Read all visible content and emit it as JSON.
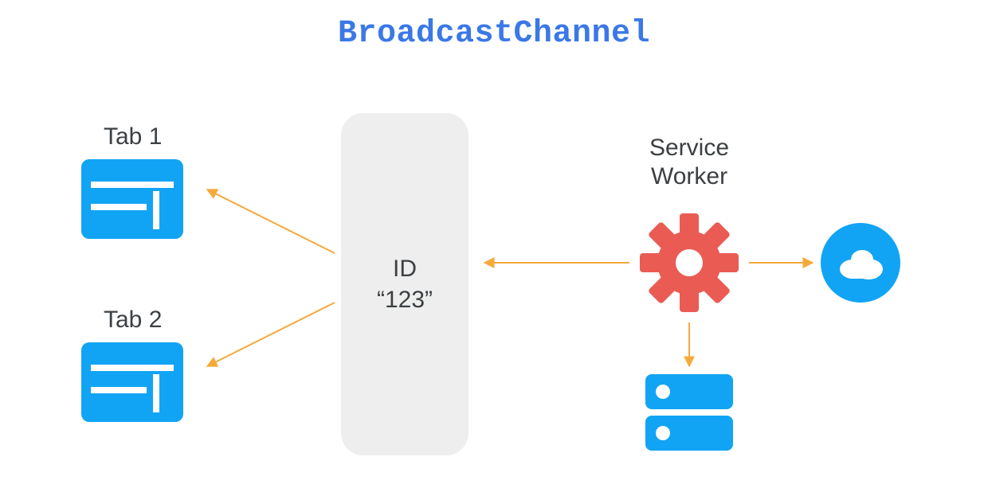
{
  "title": "BroadcastChannel",
  "channel": {
    "label_line1": "ID",
    "label_line2": "“123”"
  },
  "tabs": [
    {
      "label": "Tab 1"
    },
    {
      "label": "Tab 2"
    }
  ],
  "service_worker": {
    "label_line1": "Service",
    "label_line2": "Worker"
  },
  "colors": {
    "title": "#3b78e7",
    "pill": "#eeeeee",
    "blue": "#12a4f4",
    "red": "#ea5b54",
    "arrow": "#f6a93b",
    "white": "#ffffff",
    "text": "#3c4043"
  },
  "icons": {
    "tab": "browser-tab-icon",
    "gear": "gear-icon",
    "server": "server-icon",
    "cloud": "cloud-icon"
  },
  "arrows": [
    {
      "from": "channel",
      "to": "tab1"
    },
    {
      "from": "channel",
      "to": "tab2"
    },
    {
      "from": "service-worker",
      "to": "channel"
    },
    {
      "from": "service-worker",
      "to": "cloud"
    },
    {
      "from": "service-worker",
      "to": "server"
    }
  ]
}
